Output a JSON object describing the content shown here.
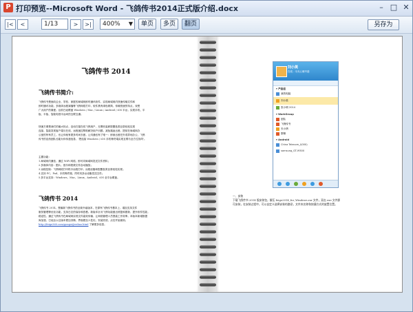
{
  "window": {
    "title": "打印预览--Microsoft Word - 飞鸽传书2014正式版介绍.docx"
  },
  "toolbar": {
    "first_label": "|<",
    "prev_label": "<",
    "page_value": "1/13",
    "next_label": ">",
    "last_label": ">|",
    "zoom_value": "400%",
    "single_page_label": "单页",
    "multi_page_label": "多页",
    "spread_label": "翻页",
    "save_as_label": "另存为"
  },
  "left_page": {
    "title": "飞鸽传书 2014",
    "section1_heading": "飞鸽传书简介:",
    "para1_lines": [
      "飞鸽传书是面向企业、学校、家庭的局域网即时通讯软件，实现局域网内快速传输文件和",
      "即时通讯功能，多媒体远程演播等飞鸽网络打印，软件具有绿色精简，传输快速的特点，深受",
      "广大用户的喜爱。目前已经覆盖 Windows / Mac / Linux / Android / iOS 平台，实现手机、平",
      "板、平板、智能电视平台间的互联互通。"
    ],
    "para2_lines": [
      "快速方便是我们的最大特点，自动扫描在线飞鸽用户，无需安装即配置各类目录轻松实现",
      "连接，智能发现客户端与在线，远程遥控帮助解决用户问题，减免路途出差，提前在局域网办",
      "公室的所有员工，也让你就有更多时间去做，让沟通也有了唯一：即使出差在外或异地办公，飞鸽",
      "传书的自然团队也能为你传递信息、'把连接 Windows / iOS 手机等终端实现互联与全方位协同'。"
    ],
    "list_title": "主要功能：",
    "list_items": [
      "1.局域网内通信，通过 WiFi 网络，即可向局域网发送文件资料；",
      "2.多媒体内容：图片，音乐和视频文件自动播放；",
      "3.远程控制：飞鸽网络打印机中远程打印，远程设备和配置各类目录轻松实现；",
      "4.支持 PC、Pad、手机等终端，同时向多台设备发送文件；",
      "5.多平台支持：Windows、Mac、Linux、Android、iOS 全平台覆盖。"
    ],
    "section2_heading": "飞鸽传书 2014",
    "para3_lines": [
      "飞鸽传书 2014，是最新飞鸽传书的全新升级版本，在原有飞鸽传书基本上，增加支持文件",
      "服务管理等优化功能，支持日志的保存和查看。新版本针对飞鸽功能做出修复和更新，提升软件性能，",
      "稳定性，通过飞鸽传书在局域网实现文件高效传输，让网络管理人员提高工作效率。本版本新增数据",
      "库加强，已经比以往版本更加流畅，界面更加人性化，安装完成，点击开始使用。"
    ],
    "link_text": "http://feige360.com/gongsi/jieshao.html",
    "link_suffix": "了解更多信息。"
  },
  "right_page": {
    "install_heading": "一、安装",
    "install_lines": [
      "下载飞鸽传书 2014 版安装包，解压 feige2014_for_Windows.rar 文件，双击 exe 文件即",
      "可安装，在安装过程中，可以自定义选择安装的路径，文件夹名称和快捷方式的放置位置。"
    ],
    "screenshot": {
      "user_name": "刘小英",
      "status_text": "在线 - 今天心情不错",
      "group1_title": "产品组",
      "group1_items": [
        "我的电脑",
        "刘小英",
        "张小明 2014"
      ],
      "group2_title": "WorkGroup",
      "group2_items": [
        "团队",
        "飞鸽传书",
        "天小鸽",
        "群聊"
      ],
      "group3_title": "Android",
      "group3_items": [
        "China Telecom_I(000)",
        "samsung_GT-I9300"
      ]
    }
  }
}
